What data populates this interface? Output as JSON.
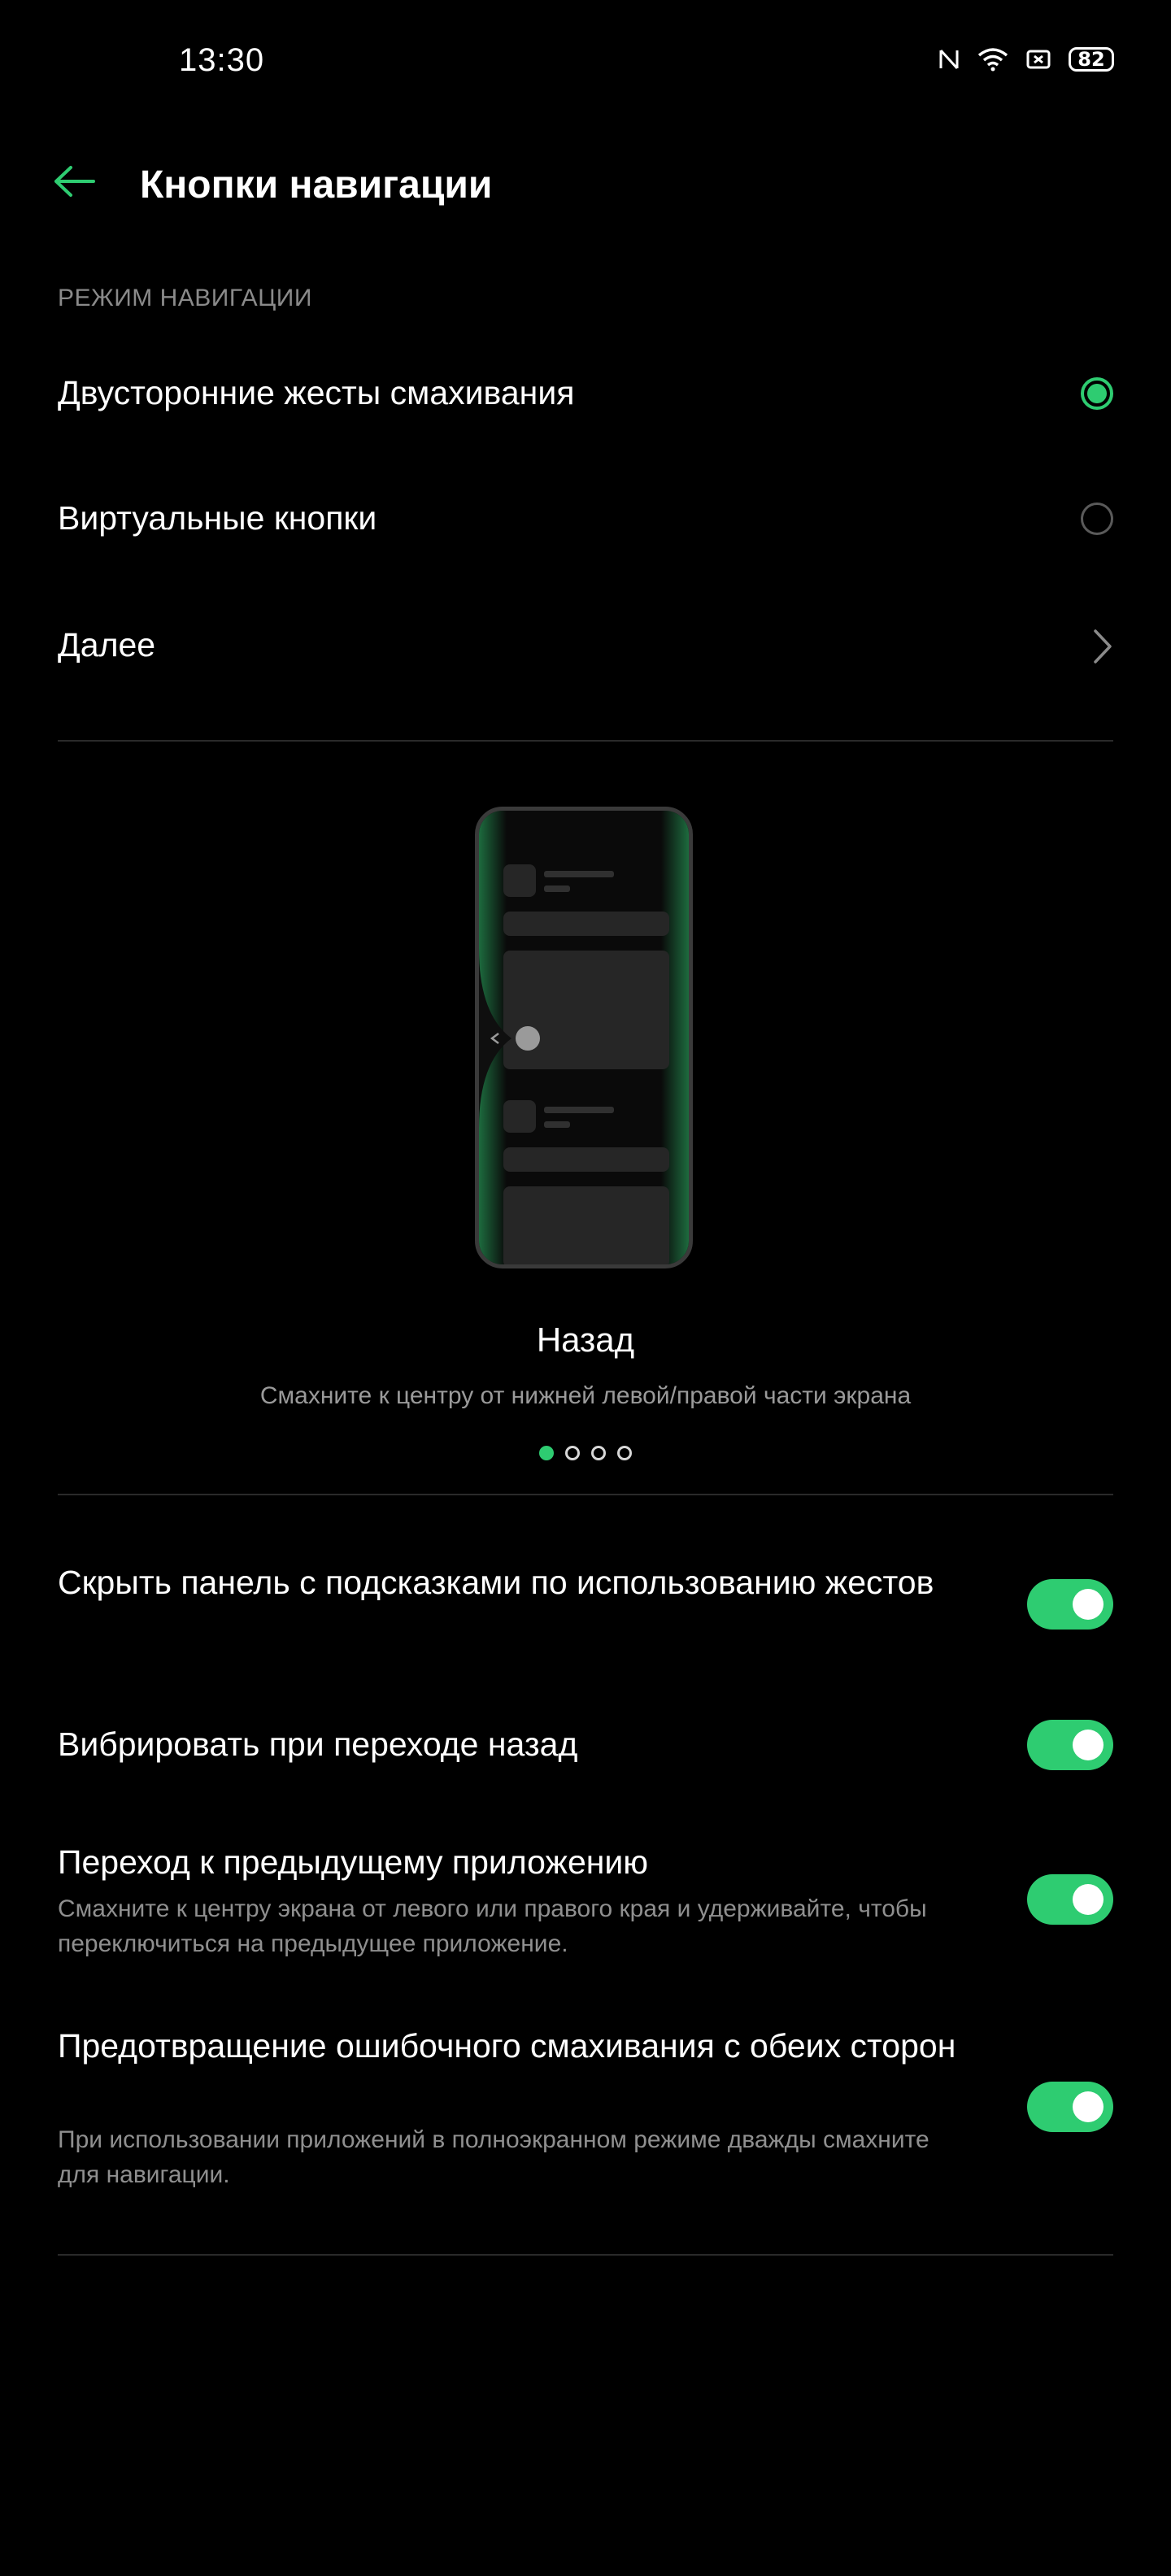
{
  "status_bar": {
    "time": "13:30",
    "icons": [
      "nfc-icon",
      "wifi-icon",
      "screenshot-icon"
    ],
    "battery": "82"
  },
  "header": {
    "back_icon": "arrow-left-icon",
    "title": "Кнопки навигации"
  },
  "navigation_mode": {
    "section_label": "РЕЖИМ НАВИГАЦИИ",
    "options": [
      {
        "label": "Двусторонние жесты смахивания",
        "selected": true
      },
      {
        "label": "Виртуальные кнопки",
        "selected": false
      }
    ],
    "more_label": "Далее"
  },
  "illustration": {
    "title": "Назад",
    "subtitle": "Смахните к центру от нижней левой/правой части экрана",
    "pages": 4,
    "active_page": 0
  },
  "switches": [
    {
      "title": "Скрыть панель с подсказками по использованию жестов",
      "description": "",
      "enabled": true
    },
    {
      "title": "Вибрировать при переходе назад",
      "description": "",
      "enabled": true
    },
    {
      "title": "Переход к предыдущему приложению",
      "description": "Смахните к центру экрана от левого или правого края и удерживайте, чтобы переключиться на предыдущее приложение.",
      "enabled": true
    },
    {
      "title": "Предотвращение ошибочного смахивания с обеих сторон",
      "description": "При использовании приложений в полноэкранном режиме дважды смахните для навигации.",
      "enabled": true
    }
  ],
  "colors": {
    "accent": "#2ecc71",
    "background": "#000000",
    "secondary_text": "#8f8f8f"
  }
}
